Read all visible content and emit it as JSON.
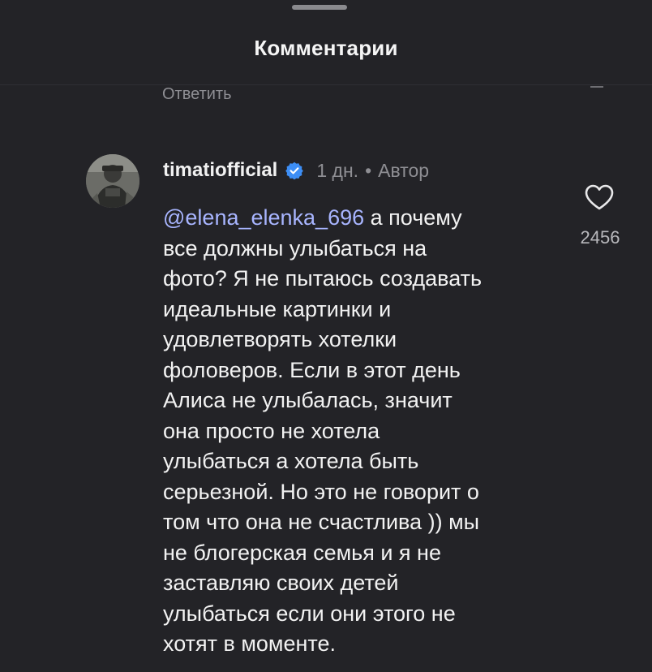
{
  "sheet": {
    "title": "Комментарии",
    "previous_reply_label": "Ответить"
  },
  "comment": {
    "username": "timatiofficial",
    "verified": true,
    "time": "1 дн.",
    "separator": "•",
    "role": "Автор",
    "mention": "@elena_elenka_696",
    "lines": [
      " а почему",
      "все должны улыбаться на",
      "фото? Я не пытаюсь создавать",
      "идеальные картинки и",
      "удовлетворять хотелки",
      "фоловеров. Если в этот день",
      "Алиса не улыбалась, значит",
      "она просто не хотела",
      "улыбаться а хотела быть",
      "серьезной. Но это не говорит о",
      "том что она не счастлива )) мы",
      "не блогерская семья и я не",
      "заставляю своих детей",
      "улыбаться если они этого не",
      "хотят в моменте."
    ],
    "like_count": "2456"
  },
  "icons": {
    "verified": "verified-badge-icon",
    "like": "heart-outline-icon"
  },
  "colors": {
    "background": "#232327",
    "mention": "#a8b5ff",
    "verified_badge": "#3d8ef5",
    "secondary_text": "#8e8e93"
  }
}
